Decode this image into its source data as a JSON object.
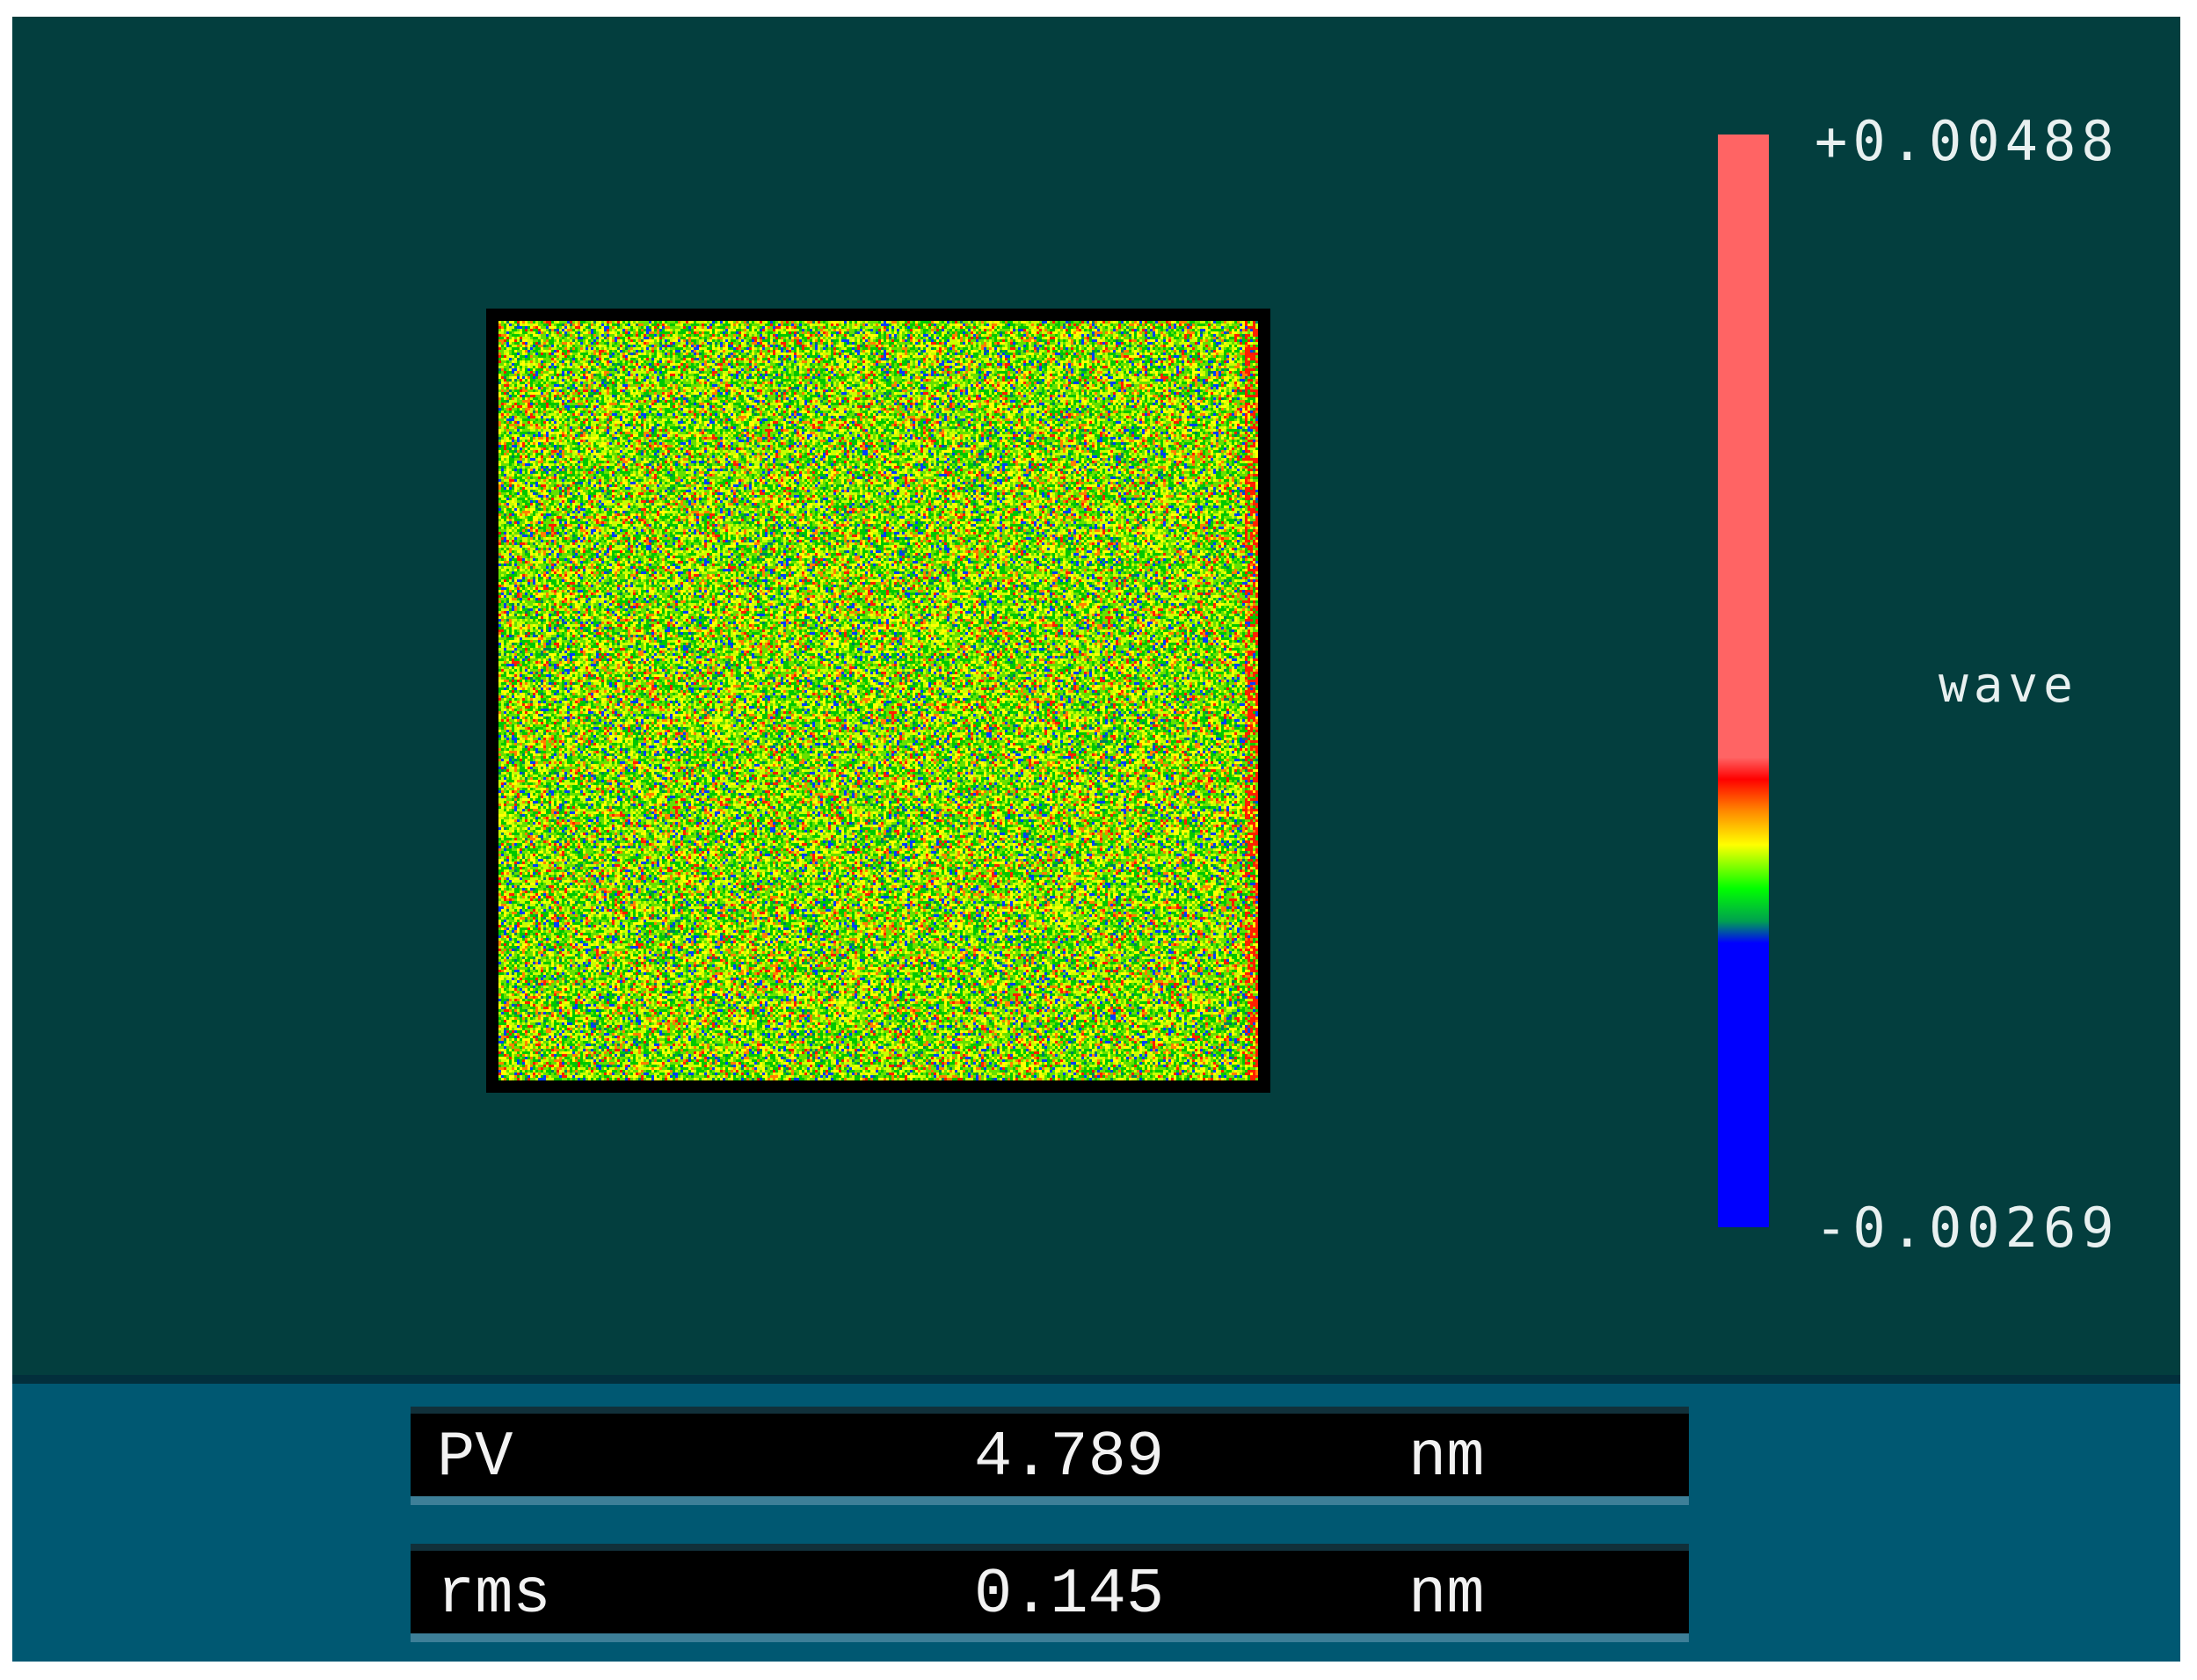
{
  "colorbar": {
    "max_label": "+0.00488",
    "min_label": "-0.00269",
    "unit_label": "wave",
    "colors": [
      "#ff6464",
      "#ff0000",
      "#ffff00",
      "#00ff00",
      "#0000ff"
    ]
  },
  "map": {
    "background": "#033e3e",
    "palette": [
      "#00c800",
      "#66e000",
      "#c8ff00",
      "#ffff00",
      "#ff8000",
      "#ff2000",
      "#0040ff",
      "#008060"
    ]
  },
  "stats": [
    {
      "label": "PV",
      "value": "4.789",
      "unit": "nm"
    },
    {
      "label": "rms",
      "value": "0.145",
      "unit": "nm"
    }
  ]
}
